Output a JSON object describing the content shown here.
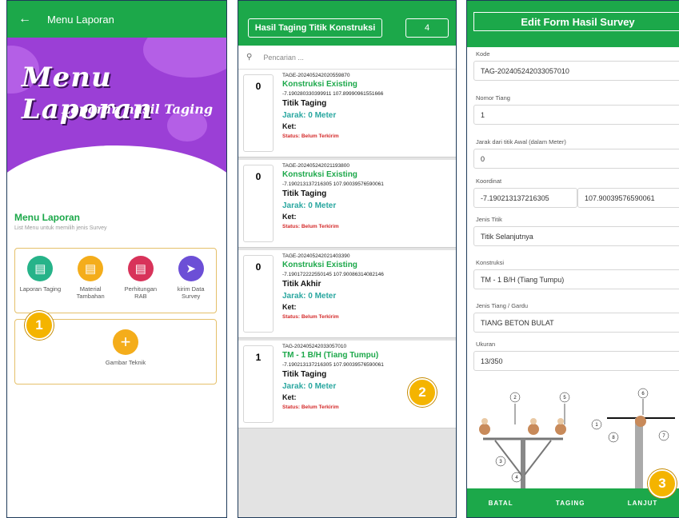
{
  "panel1": {
    "appbar_title": "Menu Laporan",
    "banner_title": "Menu Laporan",
    "banner_subtitle": "Laporan hasil Taging",
    "menu_title": "Menu Laporan",
    "menu_subtitle": "List Menu untuk memilih jenis Survey",
    "items": [
      {
        "label": "Laporan Taging",
        "icon": "list-icon",
        "color": "#26b389"
      },
      {
        "label": "Material Tambahan",
        "icon": "list-icon",
        "color": "#f4ad1b"
      },
      {
        "label": "Perhitungan RAB",
        "icon": "list-icon",
        "color": "#d8335a"
      },
      {
        "label": "kirim Data Survey",
        "icon": "send-icon",
        "color": "#6c4fd6"
      }
    ],
    "gambar_label": "Gambar Teknik",
    "gambar_icon": "plus-circle-icon",
    "badge": "1"
  },
  "panel2": {
    "title": "Hasil Taging Titik Konstruksi",
    "count": "4",
    "search_placeholder": "Pencarian ...",
    "cards": [
      {
        "num": "0",
        "code": "TAGE-202405242020559870",
        "jenis": "Konstruksi Existing",
        "coord": "-7.190280330399911 107.89990961551666",
        "titik": "Titik Taging",
        "jarak": "Jarak:  0  Meter",
        "ket": "Ket:",
        "status": "Status:  Belum Terkirim"
      },
      {
        "num": "0",
        "code": "TAGE-202405242021193800",
        "jenis": "Konstruksi Existing",
        "coord": "-7.190213137216305 107.90039576590061",
        "titik": "Titik Taging",
        "jarak": "Jarak:  0  Meter",
        "ket": "Ket:",
        "status": "Status:  Belum Terkirim"
      },
      {
        "num": "0",
        "code": "TAGE-202405242021403390",
        "jenis": "Konstruksi Existing",
        "coord": "-7.190172222550145 107.90086314082146",
        "titik": "Titik Akhir",
        "jarak": "Jarak:  0  Meter",
        "ket": "Ket:",
        "status": "Status:  Belum Terkirim"
      },
      {
        "num": "1",
        "code": "TAG-202405242033057010",
        "jenis": "TM - 1 B/H (Tiang Tumpu)",
        "coord": "-7.190213137216305 107.90039576590061",
        "titik": "Titik Taging",
        "jarak": "Jarak:  0  Meter",
        "ket": "Ket:",
        "status": "Status:  Belum Terkirim"
      }
    ],
    "badge": "2"
  },
  "panel3": {
    "title": "Edit Form Hasil Survey",
    "fields": {
      "kode_label": "Kode",
      "kode": "TAG-202405242033057010",
      "tiang_label": "Nomor Tiang",
      "tiang": "1",
      "jarak_label": "Jarak dari titik Awal (dalam Meter)",
      "jarak": "0",
      "koordinat_label": "Koordinat",
      "lat": "-7.190213137216305",
      "lng": "107.90039576590061",
      "jenis_titik_label": "Jenis Titik",
      "jenis_titik": "Titik Selanjutnya",
      "konstruksi_label": "Konstruksi",
      "konstruksi": "TM - 1 B/H (Tiang Tumpu)",
      "jenis_tiang_label": "Jenis Tiang / Gardu",
      "jenis_tiang": "TIANG BETON BULAT",
      "ukuran_label": "Ukuran",
      "ukuran": "13/350"
    },
    "diagram_labels": [
      "1",
      "2",
      "3",
      "4",
      "5",
      "6",
      "7",
      "8"
    ],
    "buttons": {
      "batal": "BATAL",
      "taging": "TAGING",
      "lanjut": "LANJUT"
    },
    "badge": "3"
  },
  "colors": {
    "green": "#1ca84a",
    "purple": "#9b3fd6",
    "badge": "#f4b400",
    "status_red": "#d42a2a",
    "teal": "#2aa7a0"
  }
}
